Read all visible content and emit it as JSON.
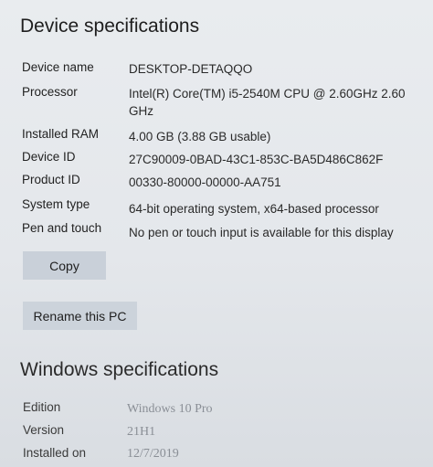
{
  "device_specs": {
    "title": "Device specifications",
    "rows": [
      {
        "label": "Device name",
        "value": "DESKTOP-DETAQQO"
      },
      {
        "label": "Processor",
        "value": "Intel(R) Core(TM) i5-2540M CPU @ 2.60GHz   2.60 GHz"
      },
      {
        "label": "Installed RAM",
        "value": "4.00 GB (3.88 GB usable)"
      },
      {
        "label": "Device ID",
        "value": "27C90009-0BAD-43C1-853C-BA5D486C862F"
      },
      {
        "label": "Product ID",
        "value": "00330-80000-00000-AA751"
      },
      {
        "label": "System type",
        "value": "64-bit operating system, x64-based processor"
      },
      {
        "label": "Pen and touch",
        "value": "No pen or touch input is available for this display"
      }
    ],
    "copy_label": "Copy",
    "rename_label": "Rename this PC"
  },
  "windows_specs": {
    "title": "Windows specifications",
    "rows": [
      {
        "label": "Edition",
        "value": "Windows 10 Pro"
      },
      {
        "label": "Version",
        "value": "21H1"
      },
      {
        "label": "Installed on",
        "value": "12/7/2019"
      }
    ]
  }
}
